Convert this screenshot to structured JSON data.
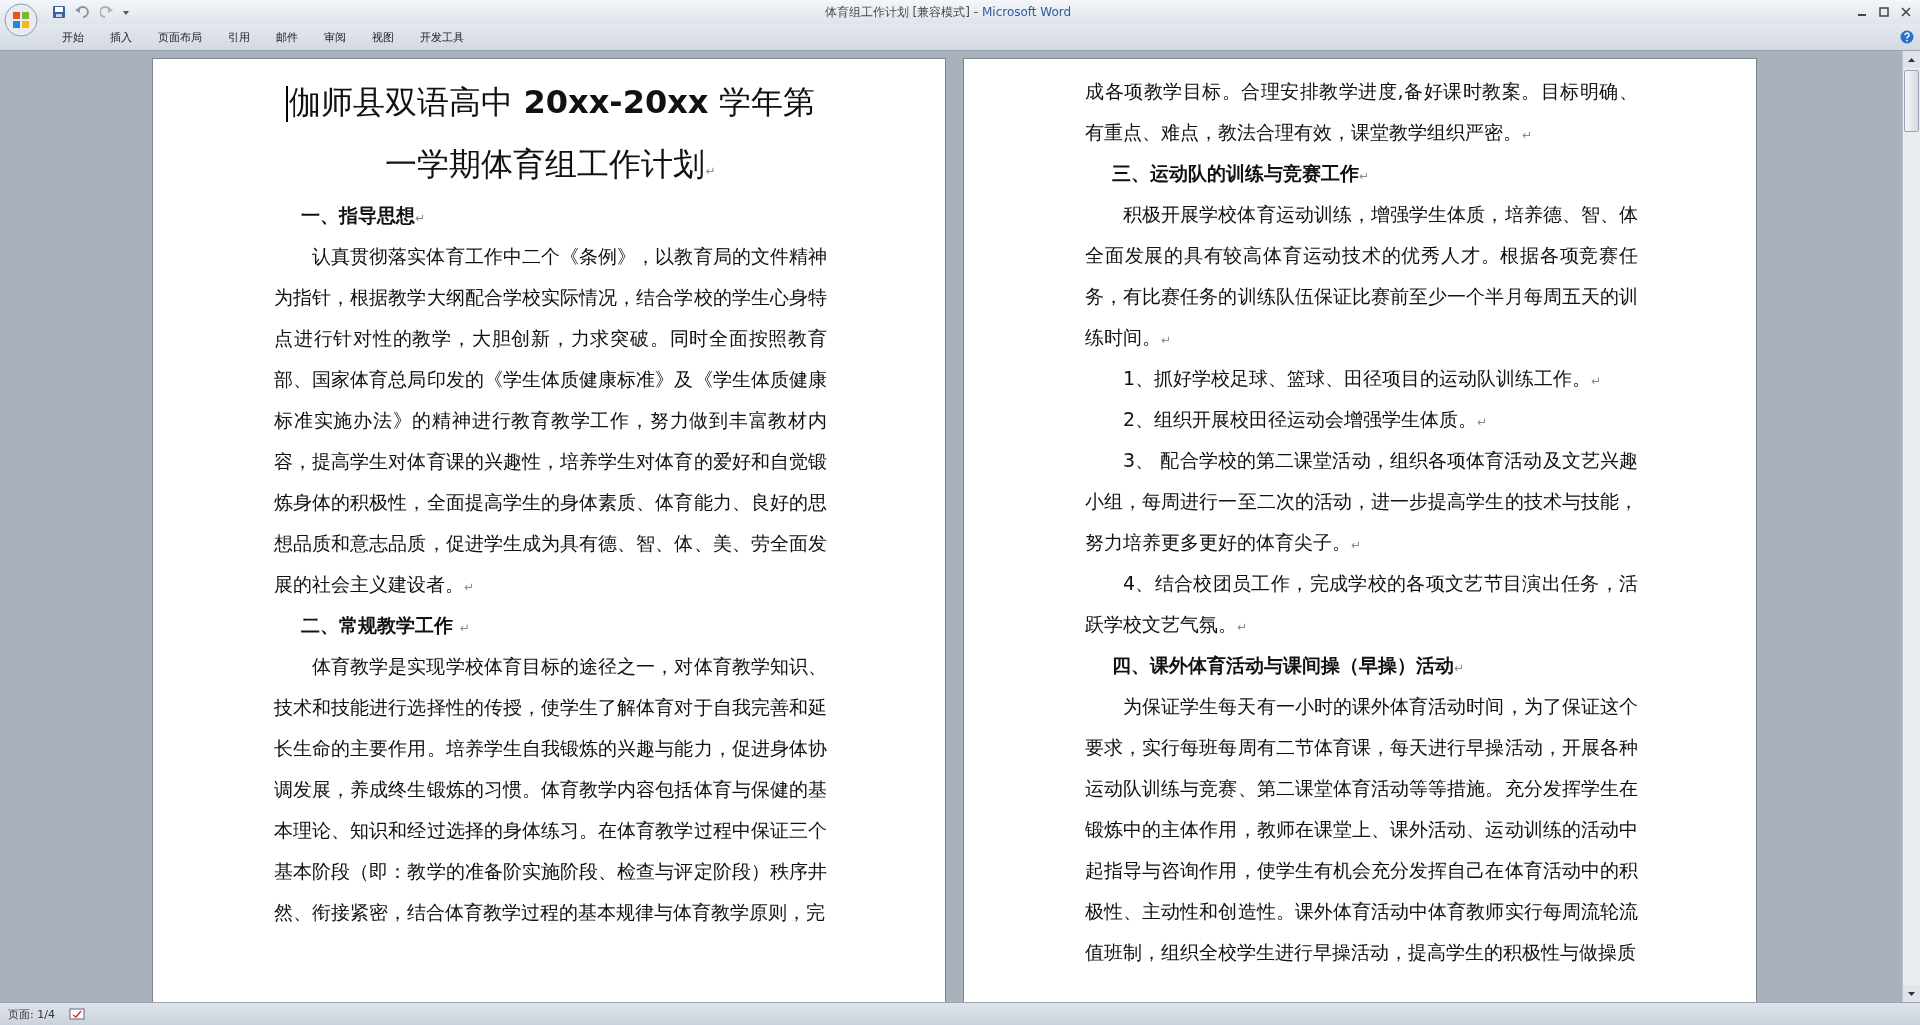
{
  "window": {
    "title": "体育组工作计划 [兼容模式] -",
    "app_name": "Microsoft Word"
  },
  "ribbon_tabs": [
    {
      "label": "开始"
    },
    {
      "label": "插入"
    },
    {
      "label": "页面布局"
    },
    {
      "label": "引用"
    },
    {
      "label": "邮件"
    },
    {
      "label": "审阅"
    },
    {
      "label": "视图"
    },
    {
      "label": "开发工具"
    }
  ],
  "pages": [
    {
      "paragraphs": [
        {
          "kind": "title",
          "text": "伽师县双语高中 **20xx-20xx** 学年第一学期体育组工作计划",
          "end_mark": "↵"
        },
        {
          "kind": "heading",
          "text": "一、指导思想",
          "end_mark": "↵"
        },
        {
          "kind": "body",
          "text": "认真贯彻落实体育工作中二个《条例》，以教育局的文件精神为指针，根据教学大纲配合学校实际情况，结合学校的学生心身特点进行针对性的教学，大胆创新，力求突破。同时全面按照教育部、国家体育总局印发的《学生体质健康标准》及《学生体质健康标准实施办法》的精神进行教育教学工作，努力做到丰富教材内容，提高学生对体育课的兴趣性，培养学生对体育的爱好和自觉锻炼身体的积极性，全面提高学生的身体素质、体育能力、良好的思想品质和意志品质，促进学生成为具有德、智、体、美、劳全面发展的社会主义建设者。",
          "end_mark": "↵"
        },
        {
          "kind": "heading",
          "text": "二、常规教学工作 ",
          "end_mark": "↵"
        },
        {
          "kind": "body",
          "text": "体育教学是实现学校体育目标的途径之一，对体育教学知识、技术和技能进行选择性的传授，使学生了解体育对于自我完善和延长生命的主要作用。培养学生自我锻炼的兴趣与能力，促进身体协调发展，养成终生锻炼的习惯。体育教学内容包括体育与保健的基本理论、知识和经过选择的身体练习。在体育教学过程中保证三个基本阶段（即：教学的准备阶实施阶段、检查与评定阶段）秩序井然、衔接紧密，结合体育教学过程的基本规律与体育教学原则，完"
        }
      ]
    },
    {
      "paragraphs": [
        {
          "kind": "continued",
          "text": "成各项教学目标。合理安排教学进度,备好课时教案。目标明确、有重点、难点，教法合理有效，课堂教学组织严密。",
          "end_mark": "↵"
        },
        {
          "kind": "heading",
          "text": "三、运动队的训练与竞赛工作",
          "end_mark": "↵"
        },
        {
          "kind": "body",
          "text": "积极开展学校体育运动训练，增强学生体质，培养德、智、体全面发展的具有较高体育运动技术的优秀人才。根据各项竞赛任务，有比赛任务的训练队伍保证比赛前至少一个半月每周五天的训练时间。",
          "end_mark": "↵"
        },
        {
          "kind": "body",
          "text": "1、抓好学校足球、篮球、田径项目的运动队训练工作。",
          "end_mark": "↵"
        },
        {
          "kind": "body",
          "text": "2、组织开展校田径运动会增强学生体质。",
          "end_mark": "↵"
        },
        {
          "kind": "body",
          "text": "3、 配合学校的第二课堂活动，组织各项体育活动及文艺兴趣小组，每周进行一至二次的活动，进一步提高学生的技术与技能，努力培养更多更好的体育尖子。",
          "end_mark": "↵"
        },
        {
          "kind": "body",
          "text": "4、结合校团员工作，完成学校的各项文艺节目演出任务，活跃学校文艺气氛。",
          "end_mark": "↵"
        },
        {
          "kind": "heading",
          "text": "四、课外体育活动与课间操（早操）活动",
          "end_mark": "↵"
        },
        {
          "kind": "body",
          "text": "为保证学生每天有一小时的课外体育活动时间，为了保证这个要求，实行每班每周有二节体育课，每天进行早操活动，开展各种运动队训练与竞赛、第二课堂体育活动等等措施。充分发挥学生在锻炼中的主体作用，教师在课堂上、课外活动、运动训练的活动中起指导与咨询作用，使学生有机会充分发挥自己在体育活动中的积极性、主动性和创造性。课外体育活动中体育教师实行每周流轮流值班制，组织全校学生进行早操活动，提高学生的积极性与做操质"
        }
      ]
    }
  ],
  "status_bar": {
    "page": "页面: 1/4"
  }
}
